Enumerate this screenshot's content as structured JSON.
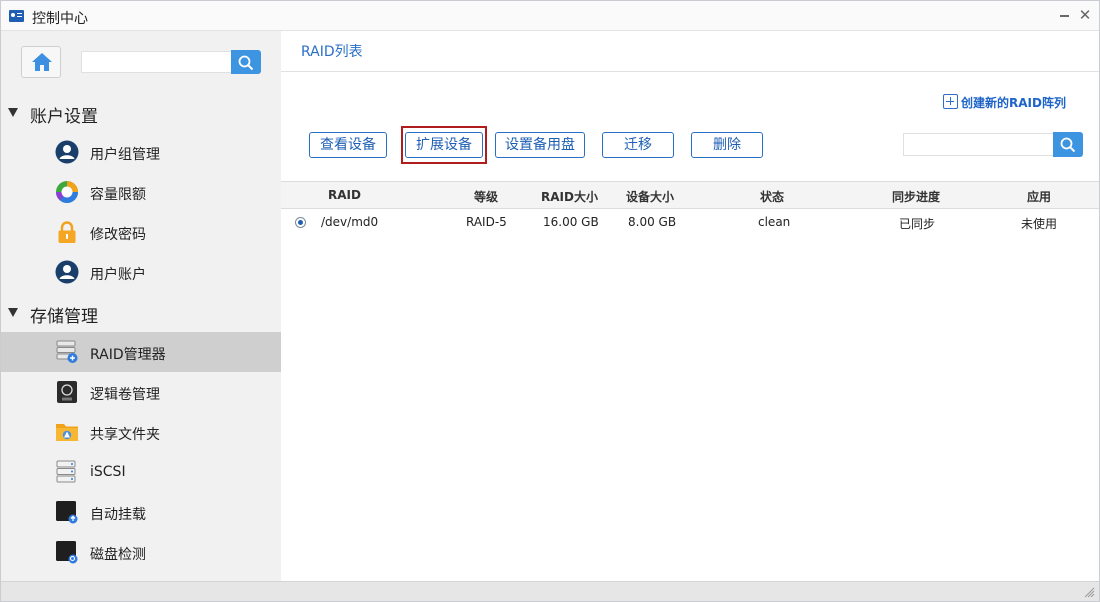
{
  "window": {
    "title": "控制中心"
  },
  "sidebar": {
    "search_placeholder": "",
    "groups": [
      {
        "label": "账户设置",
        "items": [
          {
            "label": "用户组管理",
            "icon": "user-group-icon"
          },
          {
            "label": "容量限额",
            "icon": "quota-pie-icon"
          },
          {
            "label": "修改密码",
            "icon": "lock-icon"
          },
          {
            "label": "用户账户",
            "icon": "user-account-icon"
          }
        ]
      },
      {
        "label": "存储管理",
        "items": [
          {
            "label": "RAID管理器",
            "icon": "raid-manager-icon",
            "active": true
          },
          {
            "label": "逻辑卷管理",
            "icon": "lvm-icon"
          },
          {
            "label": "共享文件夹",
            "icon": "shared-folder-icon"
          },
          {
            "label": "iSCSI",
            "icon": "iscsi-icon"
          },
          {
            "label": "自动挂载",
            "icon": "automount-icon"
          },
          {
            "label": "磁盘检测",
            "icon": "disk-check-icon"
          }
        ]
      }
    ]
  },
  "main": {
    "tab_title": "RAID列表",
    "create_link": "创建新的RAID阵列",
    "buttons": [
      "查看设备",
      "扩展设备",
      "设置备用盘",
      "迁移",
      "删除"
    ],
    "search_placeholder": "",
    "table": {
      "headers": [
        "RAID",
        "等级",
        "RAID大小",
        "设备大小",
        "状态",
        "同步进度",
        "应用"
      ],
      "rows": [
        {
          "selected": true,
          "cells": [
            "/dev/md0",
            "RAID-5",
            "16.00 GB",
            "8.00 GB",
            "clean",
            "已同步",
            "未使用"
          ]
        }
      ]
    }
  },
  "colors": {
    "accent": "#2a6fc6",
    "search_button": "#3d94e0",
    "highlight_border": "#b01d1d",
    "active_item": "#cfcfcf"
  }
}
